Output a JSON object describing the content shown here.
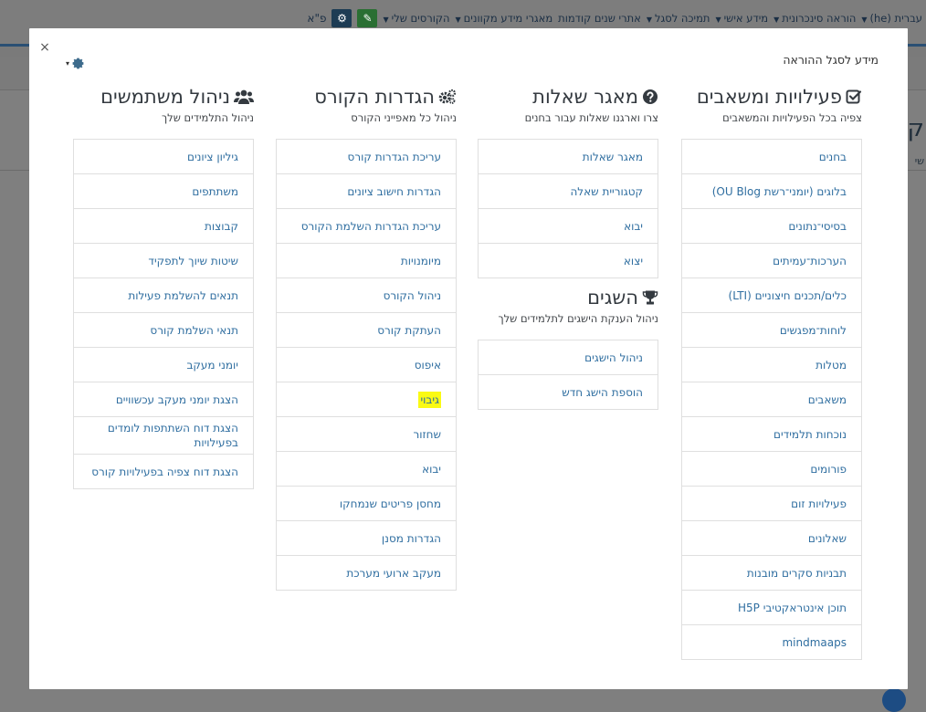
{
  "background": {
    "brand": "פ\"א",
    "nav": [
      {
        "label": "הקורסים שלי",
        "caret": true
      },
      {
        "label": "מאגרי מידע מקוונים",
        "caret": true
      },
      {
        "label": "אתרי שנים קודמות",
        "caret": false
      },
      {
        "label": "תמיכה לסגל",
        "caret": true
      },
      {
        "label": "מידע אישי",
        "caret": true
      },
      {
        "label": "הוראה סינכרונית",
        "caret": true
      },
      {
        "label": "עברית (he)",
        "caret": true
      }
    ],
    "heading": "קו",
    "subline": "שי"
  },
  "modal": {
    "title": "מידע לסגל ההוראה",
    "close": "×",
    "settings_caret": "▾"
  },
  "columns": {
    "activities": {
      "title": "פעילויות ומשאבים",
      "icon": "check-square-icon",
      "subtitle": "צפיה בכל הפעילויות והמשאבים",
      "items": [
        "בחנים",
        "בלוגים (יומני־רשת OU Blog)",
        "בסיסי־נתונים",
        "הערכות־עמיתים",
        "כלים/תכנים חיצוניים (LTI)",
        "לוחות־מפגשים",
        "מטלות",
        "משאבים",
        "נוכחות תלמידים",
        "פורומים",
        "פעילויות זום",
        "שאלונים",
        "תבניות סקרים מובנות",
        "תוכן אינטראקטיבי H5P",
        "mindmaaps"
      ]
    },
    "questionbank": {
      "title": "מאגר שאלות",
      "icon": "question-circle-icon",
      "subtitle": "צרו וארגנו שאלות עבור בחנים",
      "items": [
        "מאגר שאלות",
        "קטגוריית שאלה",
        "יבוא",
        "יצוא"
      ]
    },
    "badges": {
      "title": "השגים",
      "icon": "trophy-icon",
      "subtitle": "ניהול הענקת הישגים לתלמידים שלך",
      "items": [
        "ניהול הישגים",
        "הוספת הישג חדש"
      ]
    },
    "coursesettings": {
      "title": "הגדרות הקורס",
      "icon": "cogs-icon",
      "subtitle": "ניהול כל מאפייני הקורס",
      "items": [
        "עריכת הגדרות קורס",
        "הגדרות חישוב ציונים",
        "עריכת הגדרות השלמת הקורס",
        "מיומנויות",
        "ניהול הקורס",
        "העתקת קורס",
        "איפוס",
        "גיבוי",
        "שחזור",
        "יבוא",
        "מחסן פריטים שנמחקו",
        "הגדרות מסנן",
        "מעקב ארועי מערכת"
      ],
      "highlighted": "גיבוי"
    },
    "users": {
      "title": "ניהול משתמשים",
      "icon": "users-icon",
      "subtitle": "ניהול התלמידים שלך",
      "items": [
        "גיליון ציונים",
        "משתתפים",
        "קבוצות",
        "שיטות שיוך לתפקיד",
        "תנאים להשלמת פעילות",
        "תנאי השלמת קורס",
        "יומני מעקב",
        "הצגת יומני מעקב עכשוויים",
        "הצגת דוח השתתפות לומדים בפעילויות",
        "הצגת דוח צפיה בפעילויות קורס"
      ]
    }
  }
}
